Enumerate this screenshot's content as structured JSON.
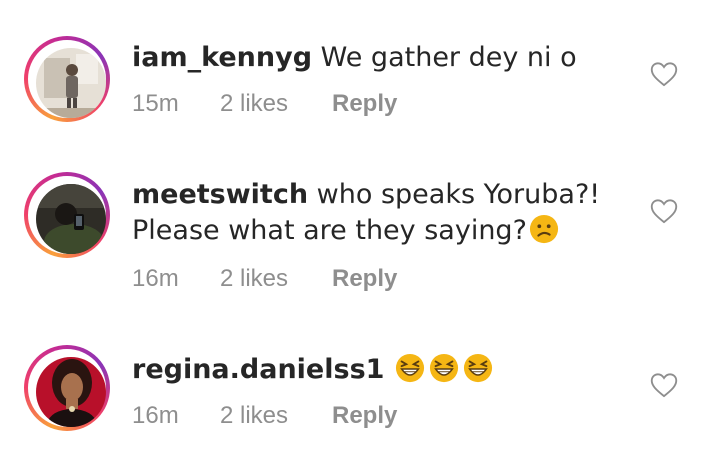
{
  "comments": [
    {
      "username": "iam_kennyg",
      "text": "We gather dey ni o",
      "time": "15m",
      "likes": "2 likes",
      "reply": "Reply",
      "avatar_icon": "profile-photo-man-standing"
    },
    {
      "username": "meetswitch",
      "text_line1": "who speaks Yoruba?!",
      "text_line2": "Please what are they saying?",
      "emoji_icon": "confused-face-emoji",
      "time": "16m",
      "likes": "2 likes",
      "reply": "Reply",
      "avatar_icon": "profile-photo-person-phone"
    },
    {
      "username": "regina.danielss1",
      "emoji_icons": [
        "grinning-squinting-face-emoji",
        "grinning-squinting-face-emoji",
        "grinning-squinting-face-emoji"
      ],
      "time": "16m",
      "likes": "2 likes",
      "reply": "Reply",
      "avatar_icon": "profile-photo-woman-red"
    }
  ],
  "colors": {
    "ring_gradient": [
      "#f9a13b",
      "#ef3f6a",
      "#c52b93",
      "#8a34b6"
    ],
    "text": "#262626",
    "meta": "#8e8e8e",
    "emoji": "#f5b614"
  }
}
